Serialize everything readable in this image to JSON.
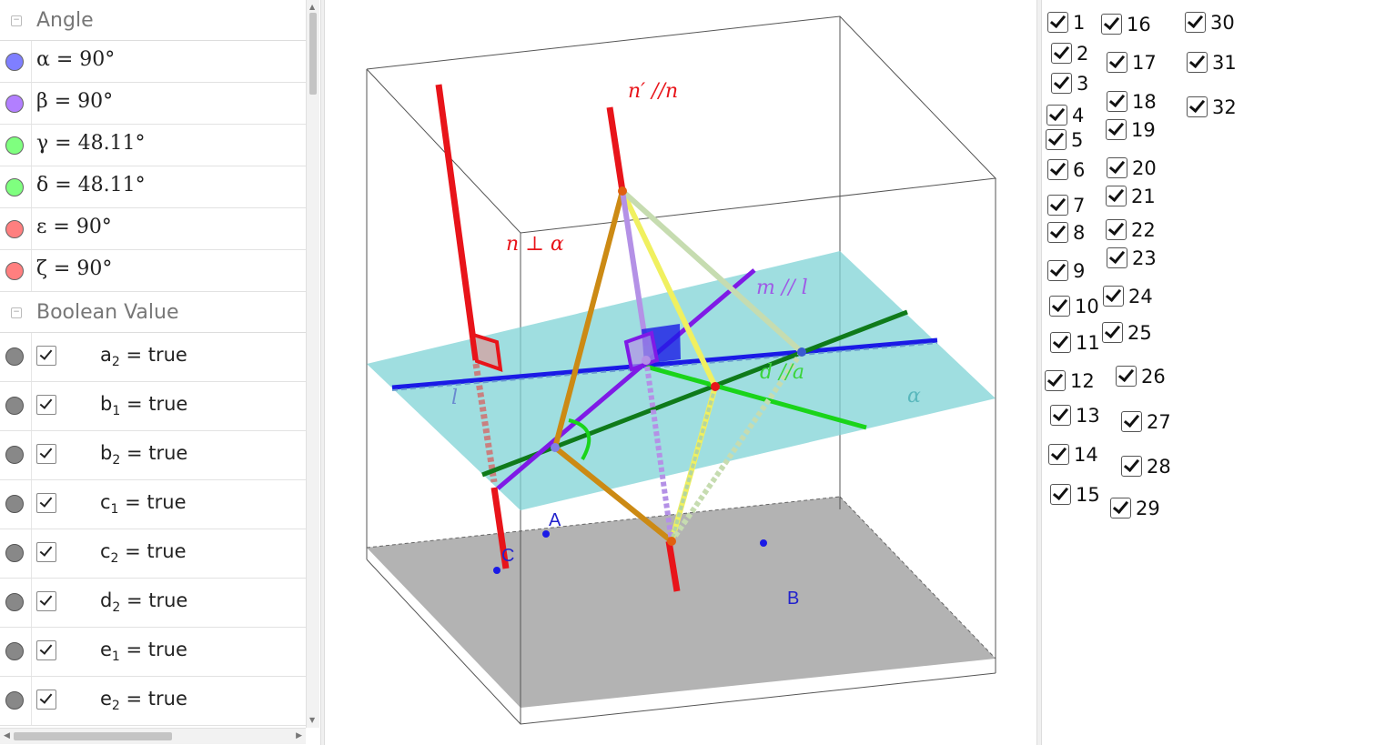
{
  "algebra": {
    "angle_group": {
      "title": "Angle",
      "toggle": "−"
    },
    "angles": [
      {
        "text": "α = 90°",
        "color": "#7f7fff"
      },
      {
        "text": "β = 90°",
        "color": "#b27fff"
      },
      {
        "text": "γ = 48.11°",
        "color": "#7fff7f"
      },
      {
        "text": "δ = 48.11°",
        "color": "#7fff7f"
      },
      {
        "text": "ε = 90°",
        "color": "#ff7f7f"
      },
      {
        "text": "ζ = 90°",
        "color": "#ff7f7f"
      }
    ],
    "boolean_group": {
      "title": "Boolean Value",
      "toggle": "−"
    },
    "booleans": [
      {
        "name": "a",
        "sub": "2",
        "value": "= true"
      },
      {
        "name": "b",
        "sub": "1",
        "value": "= true"
      },
      {
        "name": "b",
        "sub": "2",
        "value": "= true"
      },
      {
        "name": "c",
        "sub": "1",
        "value": "= true"
      },
      {
        "name": "c",
        "sub": "2",
        "value": "= true"
      },
      {
        "name": "d",
        "sub": "2",
        "value": "= true"
      },
      {
        "name": "e",
        "sub": "1",
        "value": "= true"
      },
      {
        "name": "e",
        "sub": "2",
        "value": "= true"
      }
    ]
  },
  "view3d": {
    "labels": {
      "n_prime_parallel": "n′ //n",
      "n_perp_alpha": "n ⊥ α",
      "m_parallel_l": "m // l",
      "d_parallel_a": "d //a",
      "line_l": "l",
      "plane_alpha": "α",
      "point_A": "A",
      "point_B": "B",
      "point_C": "C"
    },
    "colors": {
      "plane": "#7fd3d6",
      "floor": "#b3b3b3",
      "red": "#e8141a",
      "blue": "#1a1ae6",
      "purple": "#7f1ae6",
      "green": "#1ad41a",
      "darkgreen": "#0f7a1a",
      "orange": "#cc8a14",
      "yellow": "#f0f060",
      "lilac": "#b491e6",
      "sage": "#c6dcb0"
    }
  },
  "checkboxes": [
    "1",
    "2",
    "3",
    "4",
    "5",
    "6",
    "7",
    "8",
    "9",
    "10",
    "11",
    "12",
    "13",
    "14",
    "15",
    "16",
    "17",
    "18",
    "19",
    "20",
    "21",
    "22",
    "23",
    "24",
    "25",
    "26",
    "27",
    "28",
    "29",
    "30",
    "31",
    "32"
  ]
}
